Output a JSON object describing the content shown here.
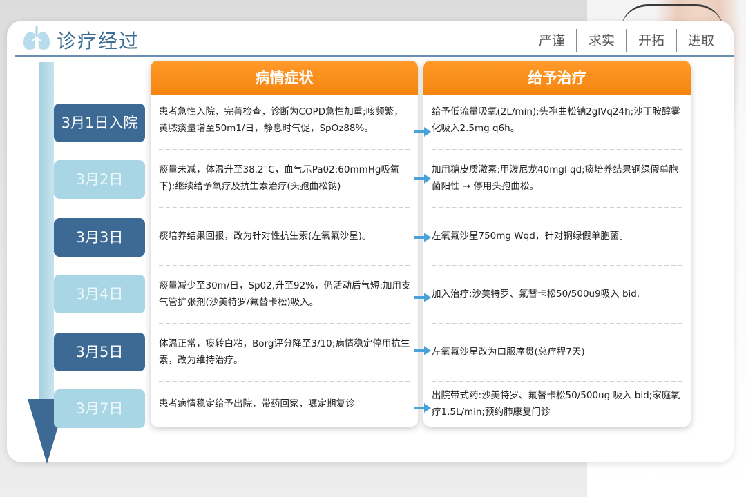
{
  "header": {
    "title": "诊疗经过",
    "mottos": [
      "严谨",
      "求实",
      "开拓",
      "进取"
    ]
  },
  "columns": {
    "symptoms_title": "病情症状",
    "treatment_title": "给予治疗"
  },
  "rows": [
    {
      "date": "3月1日入院",
      "style": "dark",
      "symptom": "患者急性入院，完善检查，诊断为COPD急性加重;咳频繁，黄脓痰量增至50m1/日，静息时气促，SpOz88%。",
      "treatment": "给予低流量吸氧(2L/min);头孢曲松钠2glVq24h;沙丁胺醇雾化吸入2.5mg q6h。"
    },
    {
      "date": "3月2日",
      "style": "light",
      "symptom": "痰量未减，体温升至38.2°C，血气示Pa02:60mmHg吸氧下);继续给予氧疗及抗生素治疗(头孢曲松钠)",
      "treatment": "加用糖皮质激素:甲泼尼龙40mgl qd;痰培养结果铜绿假单胞菌阳性 → 停用头孢曲松。"
    },
    {
      "date": "3月3日",
      "style": "dark",
      "symptom": "痰培养结果回报，改为针对性抗生素(左氧氟沙星)。",
      "treatment": "左氧氟沙星750mg Wqd，针对铜绿假单胞菌。"
    },
    {
      "date": "3月4日",
      "style": "light",
      "symptom": "痰量减少至30m/日，Sp02,升至92%，仍活动后气短:加用支气管扩张剂(沙美特罗/氟替卡松)吸入。",
      "treatment": "加入治疗:沙美特罗、氟替卡松50/500u9吸入 bid."
    },
    {
      "date": "3月5日",
      "style": "dark",
      "symptom": "体温正常，痰转白粘，Borg评分降至3/10;病情稳定停用抗生素，改为维持治疗。",
      "treatment": "左氧氟沙星改为口服序贯(总疗程7天)"
    },
    {
      "date": "3月7日",
      "style": "light",
      "symptom": "患者病情稳定给予出院，带药回家，嘱定期复诊",
      "treatment": "出院带式药:沙美特罗、氟替卡松50/500ug 吸入 bid;家庭氧疗1.5L/min;预约肺康复门诊"
    }
  ],
  "colors": {
    "accent_orange": "#f5850f",
    "date_dark": "#3d6a95",
    "date_light": "#a9d6e5",
    "title_blue": "#3c6e94",
    "arrow_blue": "#4aa3d8"
  }
}
